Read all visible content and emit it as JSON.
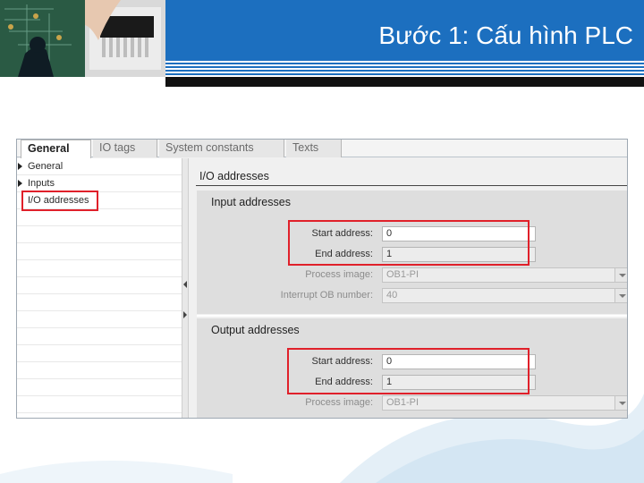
{
  "header": {
    "title": "Bước 1: Cấu hình PLC",
    "colors": {
      "band": "#1c6fbf",
      "stripes": "#1c6fbf",
      "highlight": "#e0202a"
    }
  },
  "panel": {
    "tabs": [
      {
        "label": "General",
        "active": true
      },
      {
        "label": "IO tags",
        "active": false
      },
      {
        "label": "System constants",
        "active": false
      },
      {
        "label": "Texts",
        "active": false
      }
    ],
    "nav": {
      "items": [
        {
          "label": "General",
          "expandable": true
        },
        {
          "label": "Inputs",
          "expandable": true
        },
        {
          "label": "I/O addresses",
          "expandable": false,
          "highlighted": true
        }
      ]
    },
    "content_title": "I/O addresses",
    "input_section": {
      "title": "Input addresses",
      "start_label": "Start address:",
      "start_value": "0",
      "end_label": "End address:",
      "end_value": "1",
      "process_label": "Process image:",
      "process_value": "OB1-PI",
      "interrupt_label": "Interrupt OB number:",
      "interrupt_value": "40"
    },
    "output_section": {
      "title": "Output addresses",
      "start_label": "Start address:",
      "start_value": "0",
      "end_label": "End address:",
      "end_value": "1",
      "process_label": "Process image:",
      "process_value": "OB1-PI"
    }
  }
}
